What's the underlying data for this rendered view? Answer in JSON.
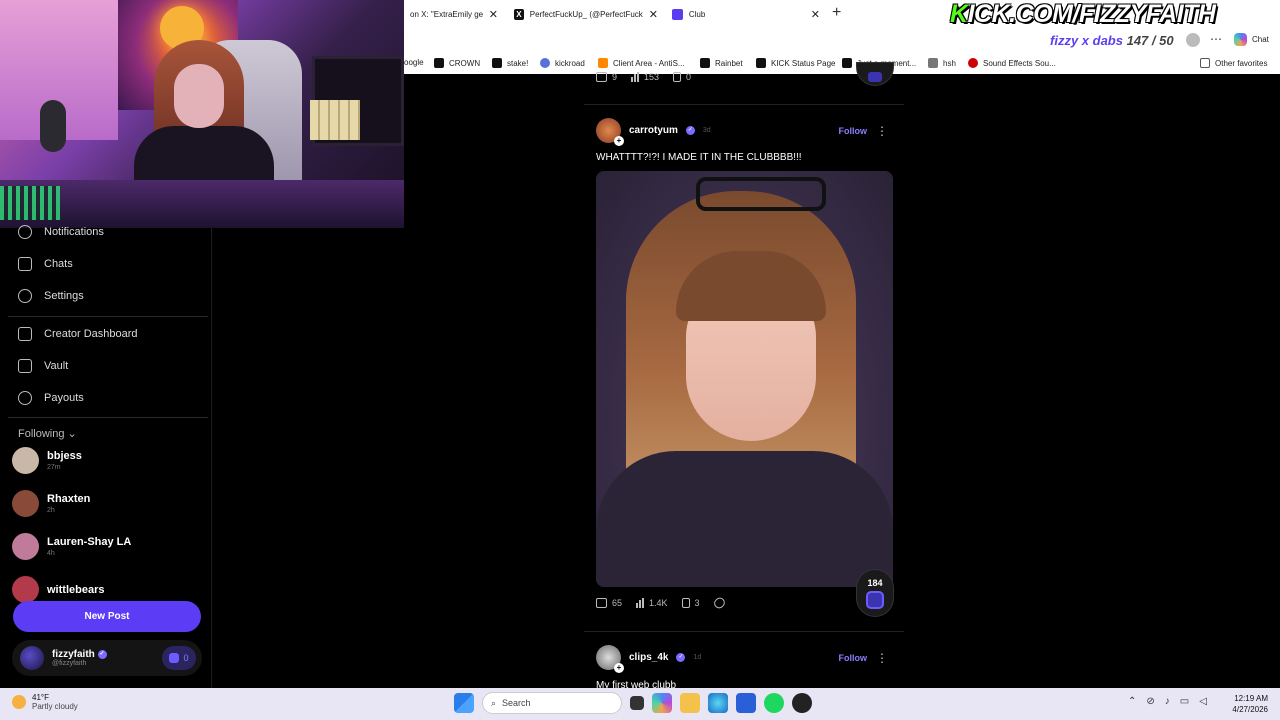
{
  "browser": {
    "tabs": [
      {
        "label": "on X: \"ExtraEmily gets k",
        "icon": "x-logo-icon"
      },
      {
        "label": "PerfectFuckUp_ (@PerfectFuckUp_",
        "icon": "x-logo-icon"
      },
      {
        "label": "Club",
        "icon": "club-icon"
      }
    ],
    "new_tab": "+",
    "close_glyph": "✕",
    "more_glyph": "⋯",
    "chat_label": "Chat",
    "bookmarks": [
      {
        "label": "oogle",
        "color": "#4285f4"
      },
      {
        "label": "CROWN",
        "color": "#111111"
      },
      {
        "label": "stake!",
        "color": "#111111"
      },
      {
        "label": "kickroad",
        "color": "#5b6fd8"
      },
      {
        "label": "Client Area - AntiS...",
        "color": "#ff8800"
      },
      {
        "label": "Rainbet",
        "color": "#111111"
      },
      {
        "label": "KICK Status Page",
        "color": "#111111"
      },
      {
        "label": "Just a moment...",
        "color": "#111111"
      },
      {
        "label": "hsh",
        "color": "#777777"
      },
      {
        "label": "Sound Effects Sou...",
        "color": "#cc0000"
      }
    ],
    "other_favorites": "Other favorites"
  },
  "stream_overlay": {
    "kick_prefix": "K",
    "kick_rest": "ICK.COM/FIZZYFAITH",
    "goal_label": "fizzy x dabs",
    "goal_count": "147 / 50"
  },
  "sidebar": {
    "nav": [
      {
        "label": "Notifications",
        "icon": "bell-icon"
      },
      {
        "label": "Chats",
        "icon": "chat-icon"
      },
      {
        "label": "Settings",
        "icon": "gear-icon"
      },
      {
        "label": "Creator Dashboard",
        "icon": "dashboard-icon"
      },
      {
        "label": "Vault",
        "icon": "vault-icon"
      },
      {
        "label": "Payouts",
        "icon": "dollar-icon"
      }
    ],
    "following_label": "Following",
    "following_chevron": "⌄",
    "following": [
      {
        "name": "bbjess",
        "time": "27m",
        "color": "#c9b8a8"
      },
      {
        "name": "Rhaxten",
        "time": "2h",
        "color": "#8a4a3a"
      },
      {
        "name": "Lauren-Shay LA",
        "time": "4h",
        "color": "#c07a9a"
      },
      {
        "name": "wittlebears",
        "time": "",
        "color": "#b23a4a"
      }
    ],
    "new_post": "New Post",
    "me": {
      "name": "fizzyfaith",
      "handle": "@fizzyfaith",
      "coins": "0"
    }
  },
  "feed": {
    "prev_post_stats": {
      "comments": "9",
      "views": "153",
      "saves": "0"
    },
    "post": {
      "username": "carrotyum",
      "age": "3d",
      "follow": "Follow",
      "caption": "WHATTTT?!?! I MADE IT IN THE CLUBBBB!!!",
      "comments": "65",
      "views": "1.4K",
      "saves": "3",
      "boost": "184"
    },
    "next_post": {
      "username": "clips_4k",
      "age": "1d",
      "follow": "Follow",
      "caption_partial": "My first web clubb"
    },
    "kebab": "⋮",
    "verified_glyph": "✓"
  },
  "taskbar": {
    "temp": "41°F",
    "weather": "Partly cloudy",
    "search": "Search",
    "time": "12:19 AM",
    "date": "4/27/2026"
  }
}
